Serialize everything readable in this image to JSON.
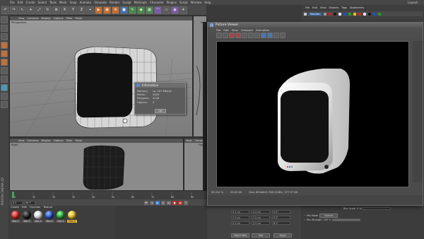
{
  "app": {
    "menu": [
      "File",
      "Edit",
      "Create",
      "Select",
      "Tools",
      "Mesh",
      "Snap",
      "Animate",
      "Simulate",
      "Render",
      "Sculpt",
      "MoGraph",
      "Character",
      "Plugins",
      "Script",
      "Window",
      "Help"
    ],
    "layout_label": "Layout:"
  },
  "viewport_menu": [
    "View",
    "Cameras",
    "Display",
    "Options",
    "Filter",
    "Panel"
  ],
  "viewports": {
    "perspective": "Perspective",
    "top": "Top",
    "right": "Right",
    "front": "Front"
  },
  "info_dialog": {
    "title": "Information",
    "rows": [
      {
        "key": "Memory:",
        "value": "ca. 187 KBytes"
      },
      {
        "key": "Points:",
        "value": "4209"
      },
      {
        "key": "Polygons:",
        "value": "4158"
      },
      {
        "key": "Objects:",
        "value": "3"
      }
    ],
    "ok_label": "OK"
  },
  "picture_viewer": {
    "title": "Picture Viewer",
    "menu": [
      "File",
      "Edit",
      "View",
      "Compare",
      "Animation"
    ],
    "status_zoom": "99.224 %",
    "status_time": "00:00:00",
    "status_size": "Size: 800x600, RGB (8-Bit), 577.97 KB"
  },
  "object_manager": {
    "menu": [
      "File",
      "Edit",
      "View",
      "Objects",
      "Tags",
      "Bookmarks"
    ],
    "object_name": "Monitor"
  },
  "material_manager": {
    "menu": [
      "Create",
      "Edit",
      "Function",
      "Texture"
    ],
    "materials": [
      {
        "name": "Mat.1",
        "color": "#d42020"
      },
      {
        "name": "Mat.2",
        "color": "#1a1a1a"
      },
      {
        "name": "Mat.3",
        "color": "#e8e8e8"
      },
      {
        "name": "Mat.4",
        "color": "#2050c8"
      },
      {
        "name": "Mat.5",
        "color": "#20a030"
      },
      {
        "name": "Mat.6",
        "color": "#f0c020"
      }
    ]
  },
  "coord_manager": {
    "rows": [
      {
        "a": "X  0 cm",
        "b": "X  0 cm",
        "c": "H  0°"
      },
      {
        "a": "Y  0 cm",
        "b": "Y  0 cm",
        "c": "P  0°"
      },
      {
        "a": "Z  0 cm",
        "b": "Z  0 cm",
        "c": "B  0°"
      }
    ],
    "apply_label": "Apply",
    "object_dropdown": "Object (Rel)",
    "size_dropdown": "Size"
  },
  "attributes": {
    "blur_offset_label": "Blur Offset",
    "blur_offset_value": "0 %",
    "blur_scale_label": "Blur Scale",
    "blur_scale_value": "0 %",
    "mix_mode_label": "Mix Mode",
    "mix_mode_value": "Normal",
    "mix_strength_label": "Mix Strength",
    "mix_strength_value": "100 %"
  },
  "timeline": {
    "start": "0 F",
    "end": "90 F",
    "ticks": [
      "0",
      "10",
      "20",
      "30",
      "40",
      "50",
      "60",
      "70",
      "80",
      "90"
    ]
  }
}
